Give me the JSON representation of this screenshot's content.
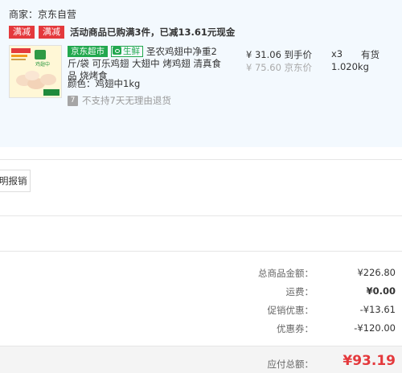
{
  "shop": {
    "merchant": "商家：京东自营"
  },
  "promotion": {
    "tags": [
      "满减",
      "满减"
    ],
    "text": "活动商品已购满3件，已减13.61元现金"
  },
  "product": {
    "badges": {
      "jd_market": "京东超市",
      "fresh": "生鲜"
    },
    "title": "圣农鸡翅中净重2斤/袋 可乐鸡翅 大翅中 烤鸡翅 清真食品 烧烤食",
    "color_label": "颜色：鸡翅中1kg",
    "return_policy": "不支持7天无理由退货",
    "return_icon_text": "7",
    "price": "¥ 31.06 到手价",
    "original_price": "¥ 75.60 京东价",
    "quantity": "x3",
    "weight": "1.020kg",
    "stock": "有货",
    "thumb_text": "鸡翅中"
  },
  "invoice": {
    "report_button": "明报销"
  },
  "summary": {
    "rows": [
      {
        "label": "总商品金额：",
        "value": "¥226.80"
      },
      {
        "label": "运费：",
        "value": "¥0.00"
      },
      {
        "label": "促销优惠：",
        "value": "-¥13.61"
      },
      {
        "label": "优惠券：",
        "value": "-¥120.00"
      }
    ],
    "total_label": "应付总额：",
    "total_value": "¥93.19"
  },
  "colors": {
    "accent_red": "#e4393c",
    "fresh_green": "#22a84e",
    "panel_bg": "#f3f9fe"
  },
  "icons": {
    "return_policy": "no-7-day-return-icon",
    "fresh": "fresh-leaf-icon"
  }
}
